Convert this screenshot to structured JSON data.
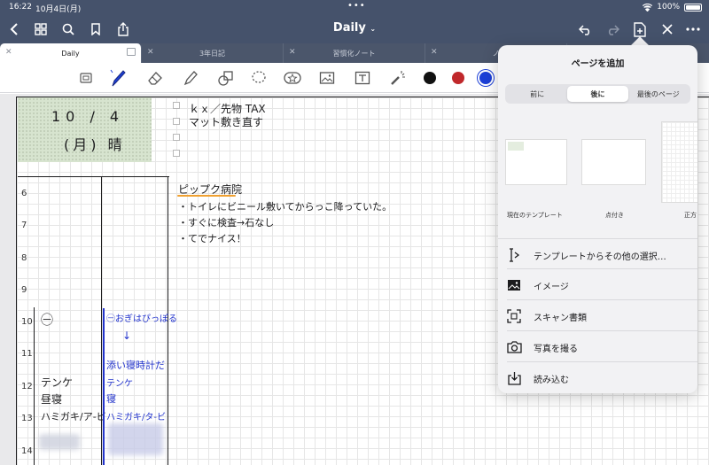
{
  "status": {
    "time": "16:22",
    "date": "10月4日(月)",
    "battery": "100%"
  },
  "navbar": {
    "title": "Daily"
  },
  "tabs": [
    {
      "label": "Daily",
      "active": true
    },
    {
      "label": "3年日記",
      "active": false
    },
    {
      "label": "習慣化ノート",
      "active": false
    },
    {
      "label": "ノ",
      "active": false
    }
  ],
  "toolbar": {
    "colors": [
      "#111111",
      "#c0282b",
      "#1c3fd6"
    ],
    "icons": [
      "scan-icon",
      "pen-icon",
      "eraser-icon",
      "highlighter-icon",
      "shapes-icon",
      "lasso-icon",
      "sticker-icon",
      "image-icon",
      "textbox-icon",
      "laser-icon"
    ]
  },
  "note": {
    "date_text": "10 / 4",
    "day_text": "(月) 晴",
    "todo_lines": [
      "ｋｘ／先物 TAX",
      "マット敷き直す"
    ],
    "hours": [
      "6",
      "7",
      "8",
      "9",
      "10",
      "11",
      "12",
      "13",
      "14"
    ],
    "main_title": "ピップク病院",
    "main_lines": [
      "・トイレにビニール敷いてからっこ降っていた。",
      "・すぐに検査→石なし",
      "・てでナイス！"
    ],
    "left_notes": [
      "㊀",
      "テンケ",
      "昼寝",
      "ハミガキ/ア-ビ"
    ],
    "blue_notes": [
      "㊀おぎはぴっぽる",
      "↓",
      "添い寝時計だ",
      "テンケ",
      "寝",
      "ハミガキ/タ-ビ"
    ]
  },
  "popover": {
    "title": "ページを追加",
    "segments": [
      "前に",
      "後に",
      "最後のページ"
    ],
    "selected_segment": "後に",
    "templates": [
      "現在のテンプレート",
      "点付き",
      "正方"
    ],
    "menu": [
      {
        "label": "テンプレートからその他の選択…",
        "icon": "template-icon"
      },
      {
        "label": "イメージ",
        "icon": "image-icon"
      },
      {
        "label": "スキャン書類",
        "icon": "scan-doc-icon"
      },
      {
        "label": "写真を撮る",
        "icon": "camera-icon"
      },
      {
        "label": "読み込む",
        "icon": "import-icon"
      }
    ]
  }
}
